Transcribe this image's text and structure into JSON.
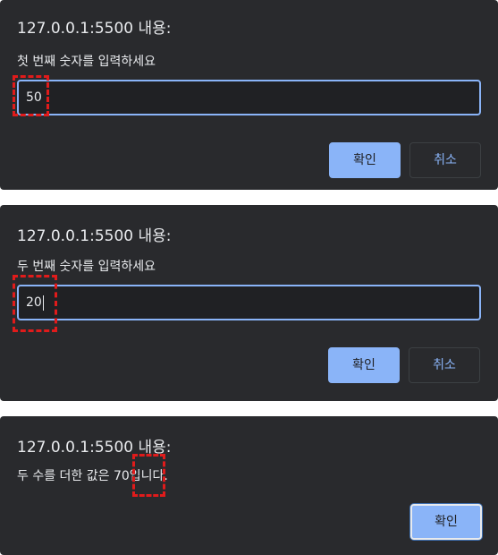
{
  "dialogs": [
    {
      "origin": "127.0.0.1:5500 내용:",
      "message": "첫 번째 숫자를 입력하세요",
      "input_value": "50",
      "ok_label": "확인",
      "cancel_label": "취소"
    },
    {
      "origin": "127.0.0.1:5500 내용:",
      "message": "두 번째 숫자를 입력하세요",
      "input_value": "20",
      "ok_label": "확인",
      "cancel_label": "취소"
    },
    {
      "origin": "127.0.0.1:5500 내용:",
      "message": "두 수를 더한 값은 70입니다.",
      "ok_label": "확인"
    }
  ],
  "colors": {
    "dialog_bg": "#292a2d",
    "input_bg": "#202124",
    "accent": "#8ab4f8",
    "text": "#e8eaed",
    "highlight": "#e01b1b"
  }
}
